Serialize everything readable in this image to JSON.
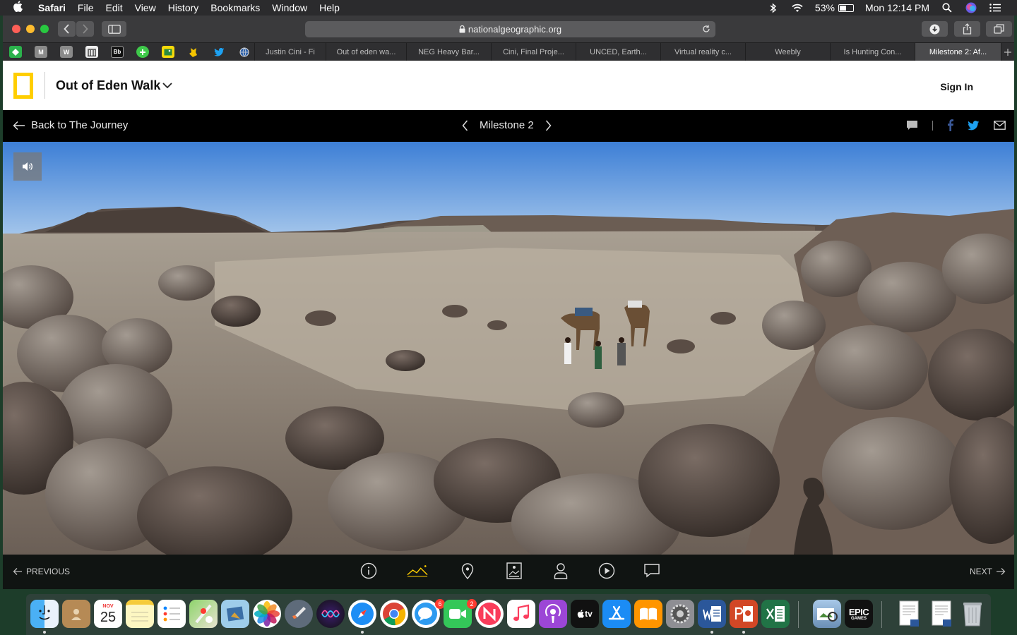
{
  "menubar": {
    "app_name": "Safari",
    "menus": [
      "File",
      "Edit",
      "View",
      "History",
      "Bookmarks",
      "Window",
      "Help"
    ],
    "battery_percent": "53%",
    "clock": "Mon 12:14 PM"
  },
  "browser": {
    "url": "nationalgeographic.org",
    "bookmark_icons": [
      "feedly-icon",
      "gmail-icon",
      "word-icon",
      "columns-icon",
      "blackboard-icon",
      "plus-icon",
      "photo-icon",
      "pokemon-icon",
      "twitter-icon",
      "globe-icon"
    ],
    "tabs": [
      {
        "label": "Justin Cini - Fi",
        "active": false
      },
      {
        "label": "Out of eden wa...",
        "active": false
      },
      {
        "label": "NEG Heavy Bar...",
        "active": false
      },
      {
        "label": "Cini, Final Proje...",
        "active": false
      },
      {
        "label": "UNCED, Earth...",
        "active": false
      },
      {
        "label": "Virtual reality c...",
        "active": false
      },
      {
        "label": "Weebly",
        "active": false
      },
      {
        "label": "Is Hunting Con...",
        "active": false
      },
      {
        "label": "Milestone 2: Af...",
        "active": true
      }
    ]
  },
  "page": {
    "site_title": "Out of Eden Walk",
    "sign_in": "Sign In",
    "back_label": "Back to The Journey",
    "milestone": "Milestone 2",
    "previous": "PREVIOUS",
    "next": "NEXT"
  },
  "controls": [
    "info-icon",
    "panorama-icon",
    "location-pin-icon",
    "photo-gallery-icon",
    "person-icon",
    "play-icon",
    "comment-icon"
  ],
  "dock": {
    "calendar_month": "NOV",
    "calendar_day": "25",
    "messages_badge": "6",
    "facetime_badge": "2",
    "appletv_label": "tv",
    "epic_label": "EPIC",
    "epic_sublabel": "GAMES"
  },
  "colors": {
    "natgeo_yellow": "#ffce00",
    "subnav_bg": "#000000",
    "safari_toolbar": "#3a3a3c"
  }
}
